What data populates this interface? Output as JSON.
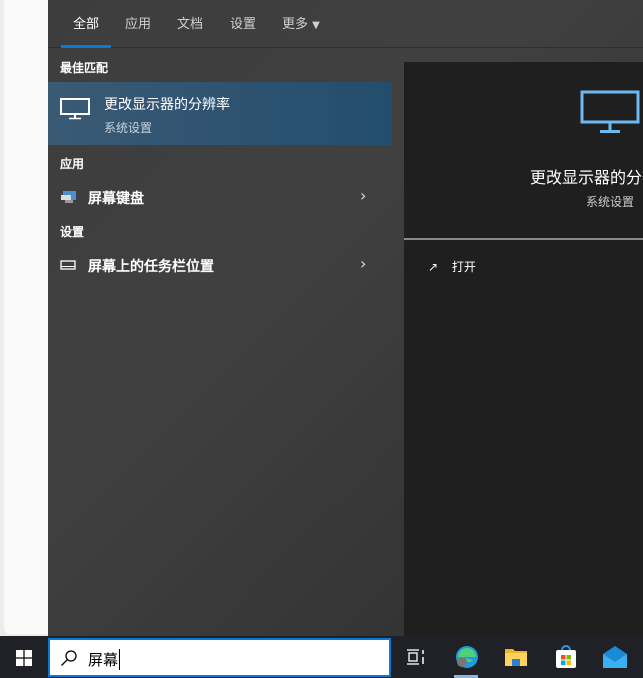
{
  "tabs": [
    "全部",
    "应用",
    "文档",
    "设置",
    "更多"
  ],
  "sections": {
    "best": "最佳匹配",
    "apps": "应用",
    "settings": "设置"
  },
  "best_match": {
    "title": "更改显示器的分辨率",
    "subtitle": "系统设置"
  },
  "apps": [
    {
      "label": "屏幕键盘"
    }
  ],
  "settings": [
    {
      "label": "屏幕上的任务栏位置"
    }
  ],
  "preview": {
    "title": "更改显示器的分辨率",
    "subtitle": "系统设置",
    "open_label": "打开"
  },
  "search": {
    "value": "屏幕"
  },
  "colors": {
    "accent": "#0a78d4",
    "preview_icon": "#6cb8f0"
  }
}
